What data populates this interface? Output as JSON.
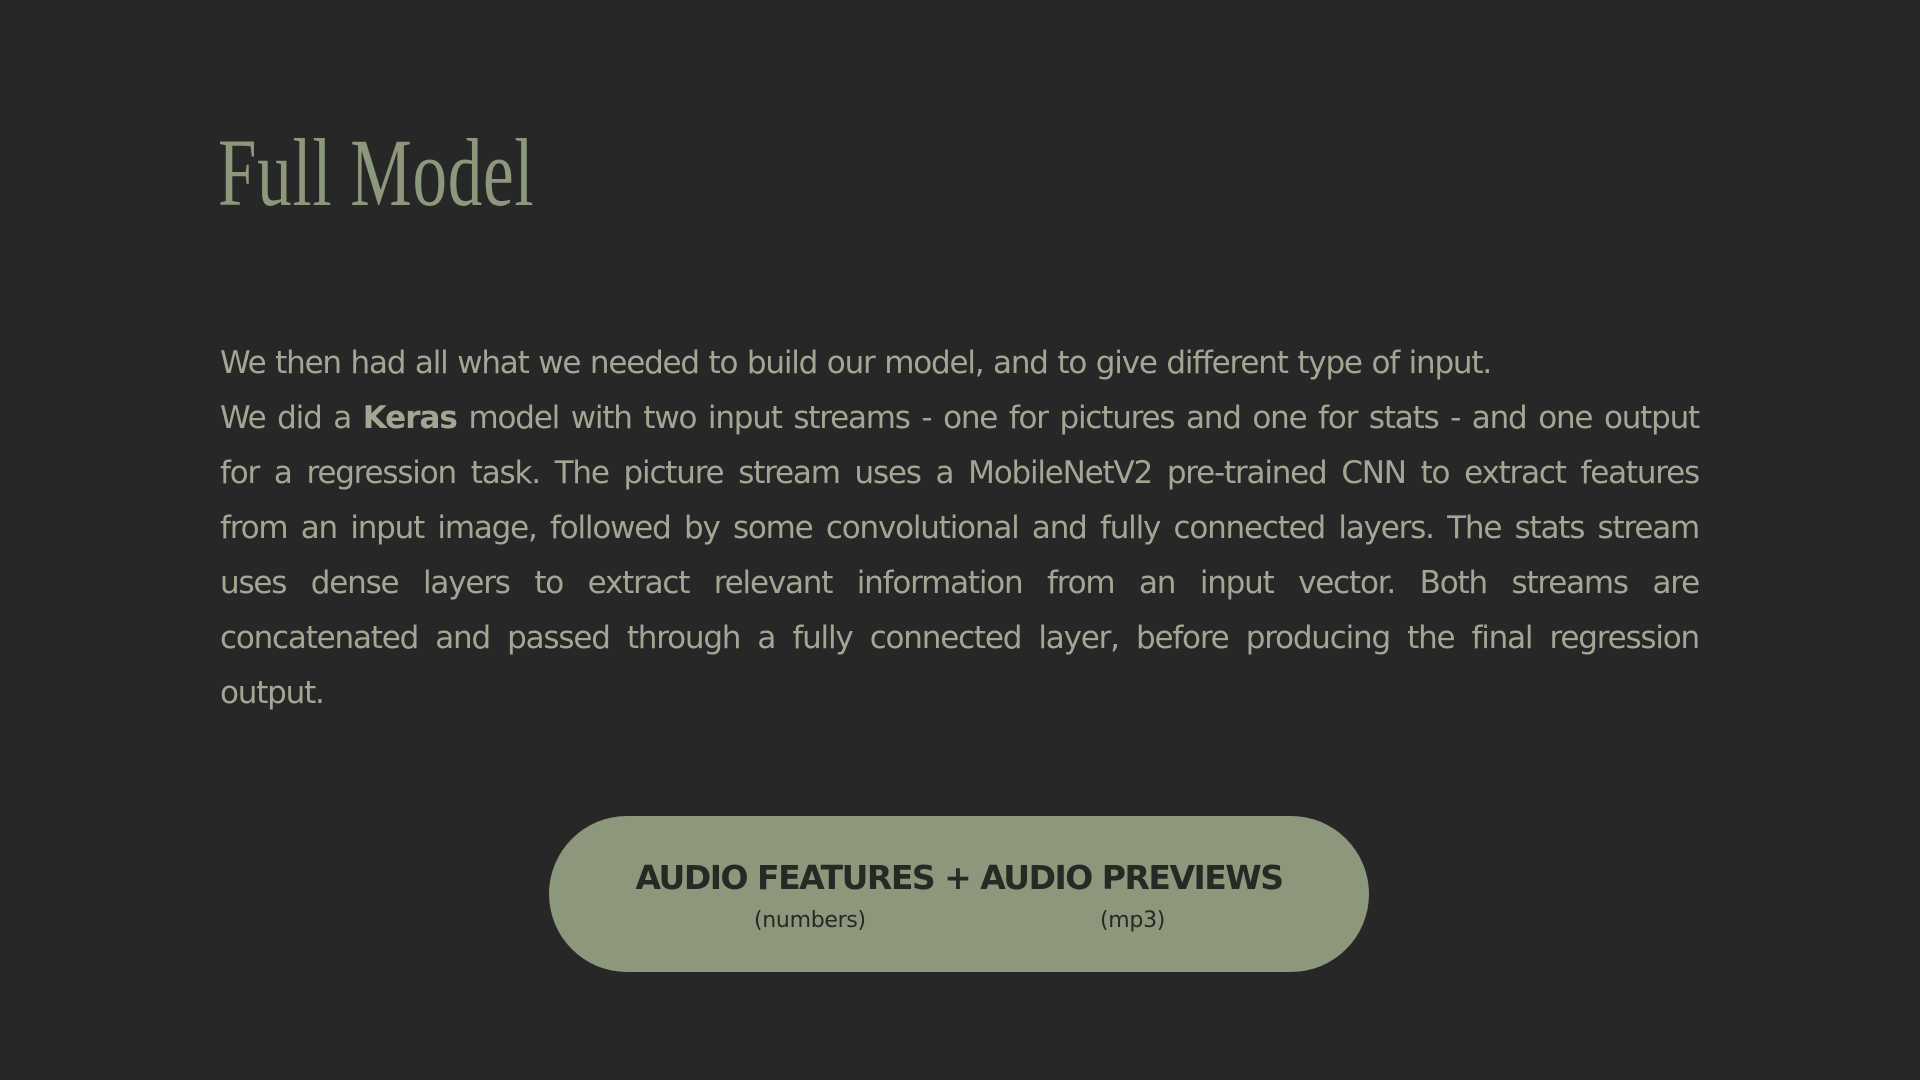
{
  "slide": {
    "title": "Full Model",
    "intro": "We then had all what we needed to build our model, and to give different type of input.",
    "para_before": "We did a ",
    "para_bold": "Keras",
    "para_after": " model with two input streams - one for pictures and one for stats - and one output for a regression task. The picture stream uses a MobileNetV2 pre-trained CNN to extract features from an input image, followed by some convolutional and fully connected layers. The stats stream uses dense layers to extract relevant information from an input vector. Both streams are concatenated and passed through a fully connected layer, before producing the final regression output."
  },
  "pill": {
    "title": "AUDIO FEATURES + AUDIO PREVIEWS",
    "left_sub": "(numbers)",
    "right_sub": "(mp3)"
  },
  "colors": {
    "background": "#272727",
    "accent": "#8c977c",
    "body_text": "#a2a794",
    "pill_text": "#262924"
  }
}
